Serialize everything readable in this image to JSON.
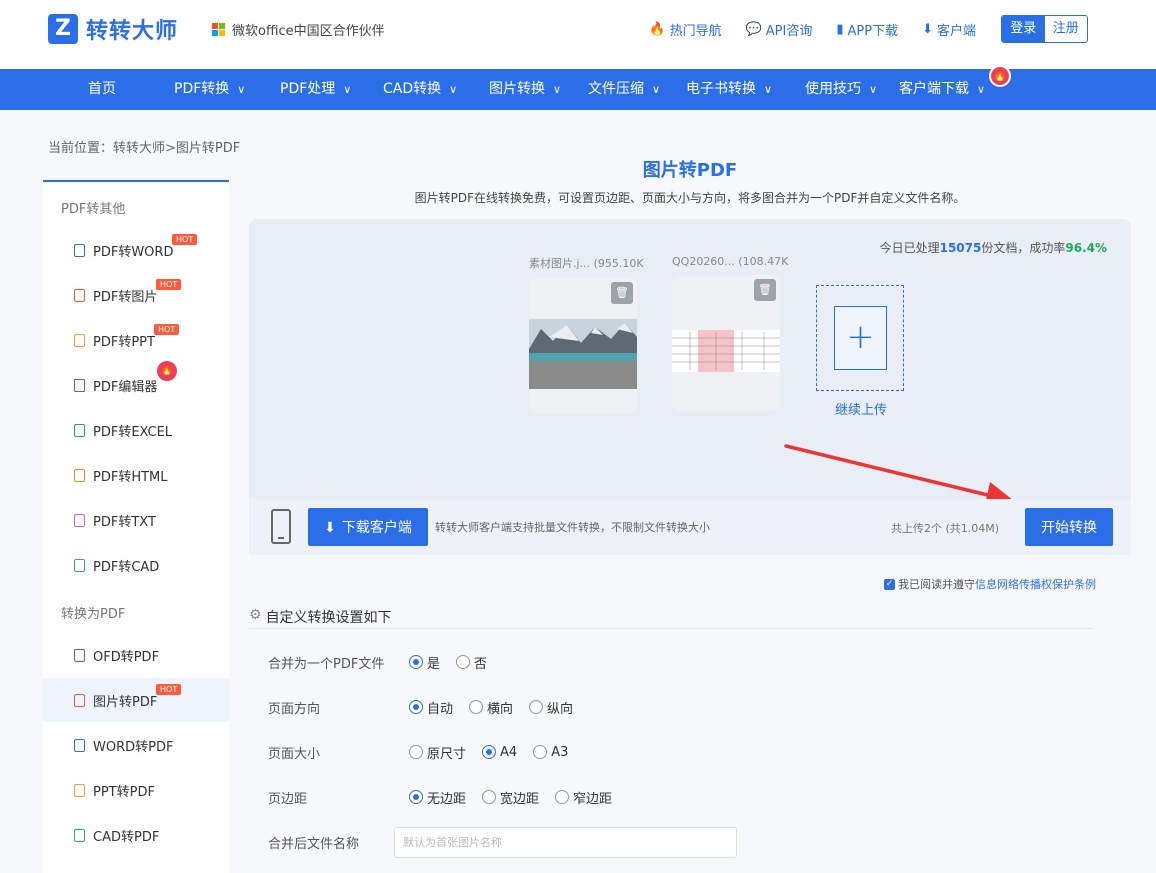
{
  "header": {
    "logo_mark": "Z",
    "logo_text": "转转大师",
    "partner": "微软office中国区合作伙伴",
    "links": [
      {
        "icon": "fire-icon",
        "glyph": "🔥",
        "label": "热门导航"
      },
      {
        "icon": "chat-icon",
        "glyph": "💬",
        "label": "API咨询"
      },
      {
        "icon": "phone-icon",
        "glyph": "▮",
        "label": "APP下载"
      },
      {
        "icon": "download-icon",
        "glyph": "⬇",
        "label": "客户端"
      }
    ],
    "login": "登录",
    "register": "注册"
  },
  "nav": {
    "items": [
      "首页",
      "PDF转换",
      "PDF处理",
      "CAD转换",
      "图片转换",
      "文件压缩",
      "电子书转换",
      "使用技巧",
      "客户端下载"
    ],
    "fire_glyph": "🔥"
  },
  "breadcrumb": "当前位置：转转大师>图片转PDF",
  "sidebar": {
    "group1": "PDF转其他",
    "items1": [
      {
        "label": "PDF转WORD",
        "hot": "HOT",
        "color": "#3a6fd8"
      },
      {
        "label": "PDF转图片",
        "hot": "HOT",
        "color": "#e8584f"
      },
      {
        "label": "PDF转PPT",
        "hot": "HOT",
        "color": "#f0a030"
      },
      {
        "label": "PDF编辑器",
        "hot": "",
        "color": "#3a6fd8"
      },
      {
        "label": "PDF转EXCEL",
        "hot": "",
        "color": "#28a060"
      },
      {
        "label": "PDF转HTML",
        "hot": "",
        "color": "#f08a30"
      },
      {
        "label": "PDF转TXT",
        "hot": "",
        "color": "#d860b0"
      },
      {
        "label": "PDF转CAD",
        "hot": "",
        "color": "#30a8a0"
      }
    ],
    "group2": "转换为PDF",
    "items2": [
      {
        "label": "OFD转PDF",
        "hot": "",
        "color": "#3a6fd8"
      },
      {
        "label": "图片转PDF",
        "hot": "HOT",
        "color": "#e8584f"
      },
      {
        "label": "WORD转PDF",
        "hot": "",
        "color": "#3a6fd8"
      },
      {
        "label": "PPT转PDF",
        "hot": "",
        "color": "#f0a030"
      },
      {
        "label": "CAD转PDF",
        "hot": "",
        "color": "#30a8a0"
      }
    ]
  },
  "main": {
    "title": "图片转PDF",
    "subtitle": "图片转PDF在线转换免费，可设置页边距、页面大小与方向，将多图合并为一个PDF并自定义文件名称。",
    "stats_prefix": "今日已处理",
    "stats_count": "15075",
    "stats_mid": "份文档，成功率",
    "stats_rate": "96.4%",
    "files": [
      {
        "name": "素材图片.j... (955.10K"
      },
      {
        "name": "QQ20260... (108.47K"
      }
    ],
    "add_label": "继续上传",
    "download_btn": "下载客户端",
    "download_note": "转转大师客户端支持批量文件转换，不限制文件转换大小",
    "upload_count": "共上传2个 (共1.04M)",
    "start_btn": "开始转换",
    "agree_text": "我已阅读并遵守",
    "agree_link": "信息网络传播权保护条例",
    "settings_title": "自定义转换设置如下",
    "merge_label": "合并为一个PDF文件",
    "merge_opts": [
      "是",
      "否"
    ],
    "orient_label": "页面方向",
    "orient_opts": [
      "自动",
      "横向",
      "纵向"
    ],
    "size_label": "页面大小",
    "size_opts": [
      "原尺寸",
      "A4",
      "A3"
    ],
    "margin_label": "页边距",
    "margin_opts": [
      "无边距",
      "宽边距",
      "窄边距"
    ],
    "filename_label": "合并后文件名称",
    "filename_placeholder": "默认为首张图片名称"
  },
  "colors": {
    "brand": "#2b6fe8",
    "arrow": "#ee3333",
    "hot": "#ff5a3c"
  }
}
